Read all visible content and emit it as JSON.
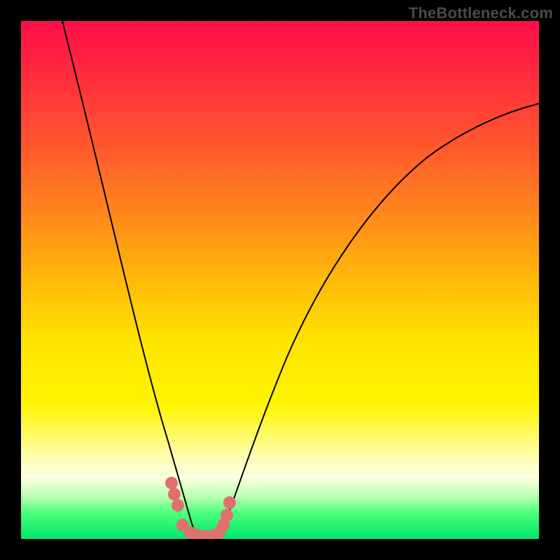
{
  "watermark": "TheBottleneck.com",
  "colors": {
    "frame": "#000000",
    "marker": "#e07070",
    "curve": "#000000"
  },
  "chart_data": {
    "type": "line",
    "title": "",
    "xlabel": "",
    "ylabel": "",
    "xlim": [
      0,
      100
    ],
    "ylim": [
      0,
      100
    ],
    "series": [
      {
        "name": "left-branch",
        "x": [
          8,
          10,
          12,
          14,
          16,
          18,
          20,
          22,
          24,
          26,
          28,
          30,
          31,
          32,
          33
        ],
        "y": [
          100,
          92,
          84,
          76,
          68,
          60,
          52,
          44,
          36,
          28,
          20,
          12,
          8,
          5,
          3
        ]
      },
      {
        "name": "right-branch",
        "x": [
          38,
          40,
          43,
          47,
          52,
          58,
          65,
          72,
          80,
          88,
          95,
          100
        ],
        "y": [
          3,
          6,
          12,
          22,
          34,
          46,
          57,
          66,
          73,
          78,
          82,
          84
        ]
      }
    ],
    "markers": [
      {
        "x": 29.0,
        "y": 11
      },
      {
        "x": 29.5,
        "y": 9
      },
      {
        "x": 30.0,
        "y": 7
      },
      {
        "x": 31.0,
        "y": 3
      },
      {
        "x": 32.5,
        "y": 2
      },
      {
        "x": 34.0,
        "y": 2
      },
      {
        "x": 35.5,
        "y": 2
      },
      {
        "x": 37.0,
        "y": 2
      },
      {
        "x": 38.0,
        "y": 3
      },
      {
        "x": 38.8,
        "y": 5
      },
      {
        "x": 39.5,
        "y": 7
      },
      {
        "x": 40.0,
        "y": 10
      }
    ],
    "background_gradient": {
      "direction": "vertical",
      "stops": [
        {
          "pos": 0.0,
          "color": "#ff0e4a"
        },
        {
          "pos": 0.5,
          "color": "#ffb909"
        },
        {
          "pos": 0.74,
          "color": "#fff500"
        },
        {
          "pos": 0.88,
          "color": "#fdffe0"
        },
        {
          "pos": 1.0,
          "color": "#00e66a"
        }
      ]
    }
  }
}
